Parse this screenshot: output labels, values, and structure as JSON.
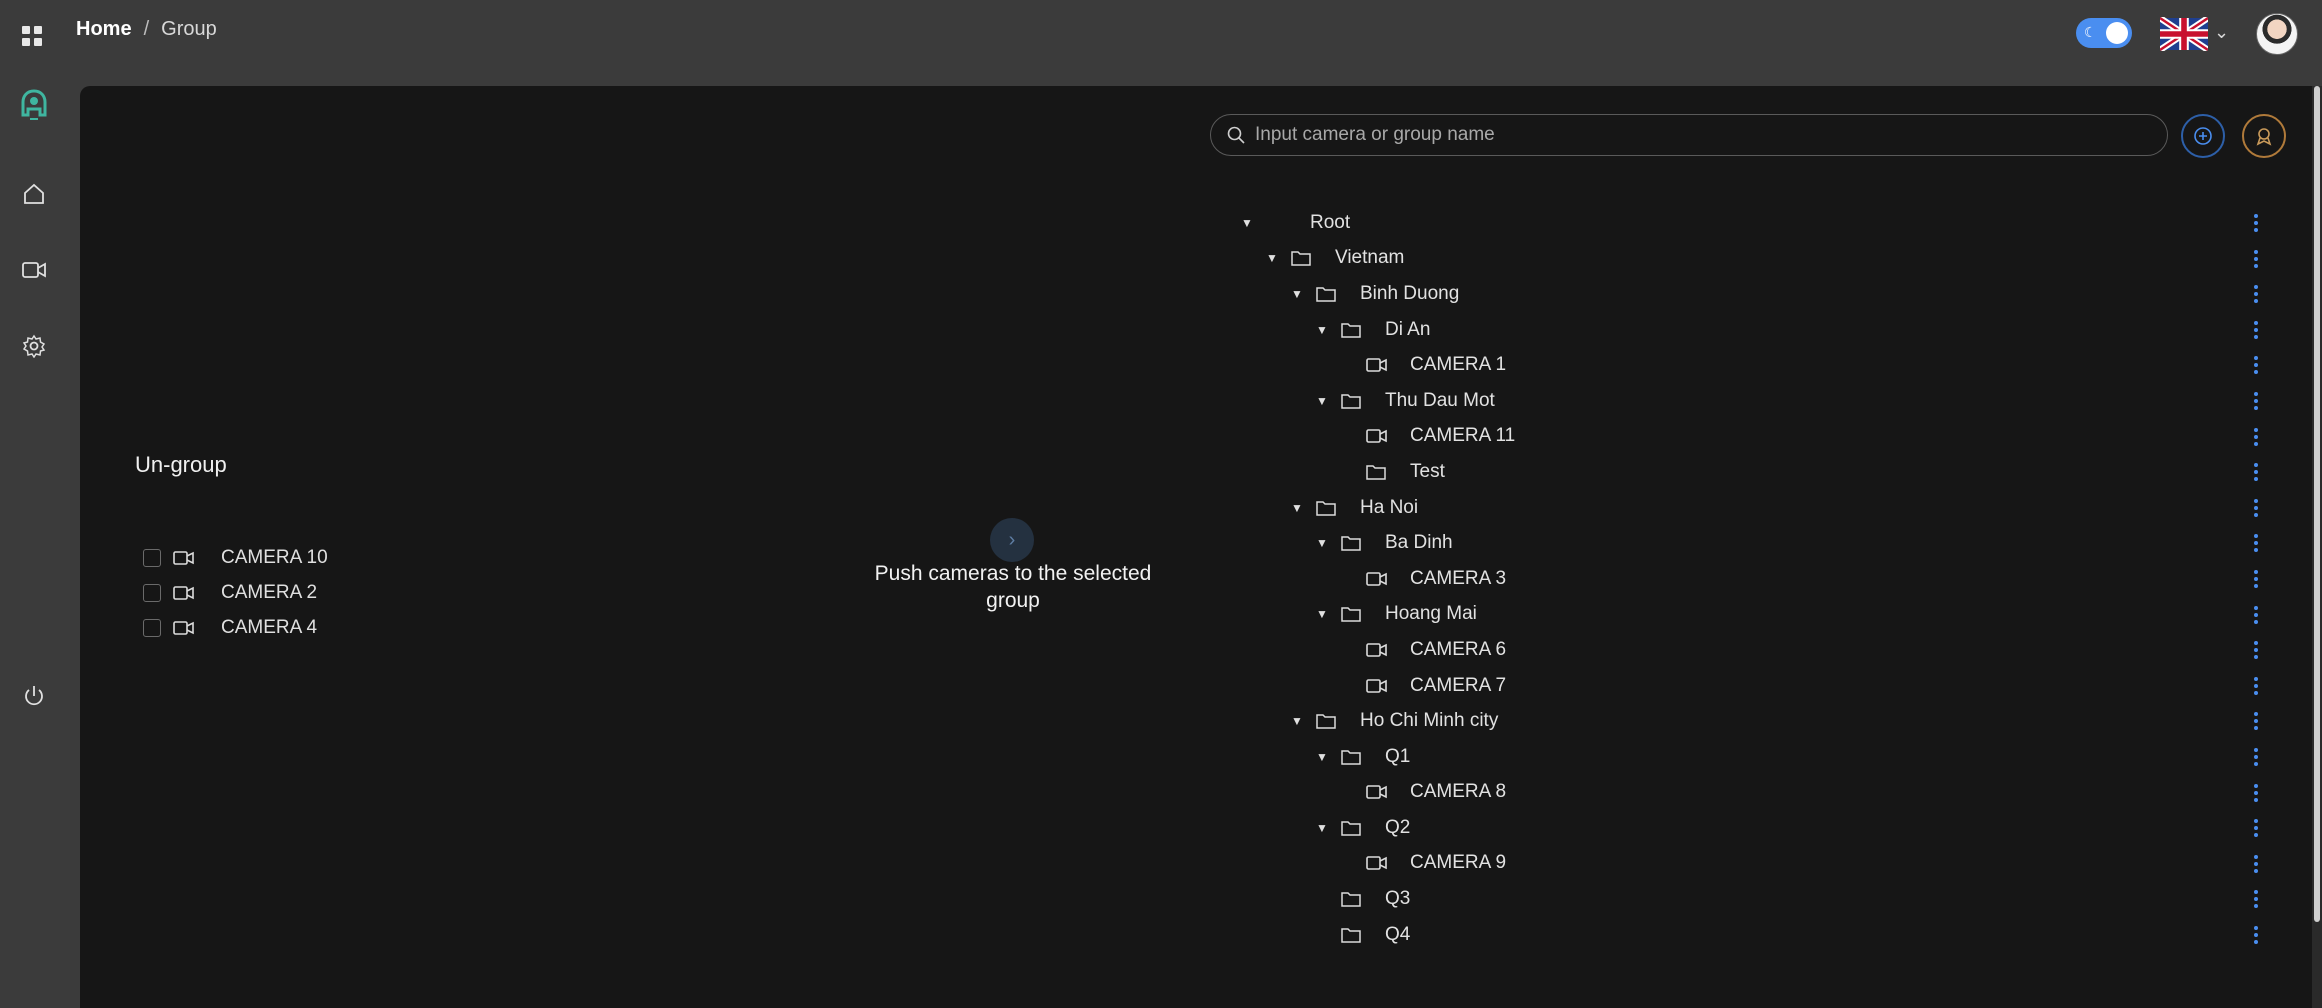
{
  "header": {
    "breadcrumb": {
      "home": "Home",
      "separator": "/",
      "current": "Group"
    },
    "theme_toggle_on": true,
    "language_icon": "uk-flag-icon"
  },
  "sidebar": {
    "items": [
      {
        "icon": "app-logo-icon"
      },
      {
        "icon": "home-icon"
      },
      {
        "icon": "camera-icon"
      },
      {
        "icon": "settings-icon"
      },
      {
        "icon": "power-icon"
      }
    ]
  },
  "ungroup": {
    "title": "Un-group",
    "items": [
      {
        "label": "CAMERA 10"
      },
      {
        "label": "CAMERA 2"
      },
      {
        "label": "CAMERA 4"
      }
    ]
  },
  "push": {
    "label": "Push cameras to the selected group"
  },
  "search": {
    "placeholder": "Input camera or group name"
  },
  "tree": {
    "nodes": [
      {
        "label": "Root",
        "level": 0,
        "type": "root",
        "expanded": true
      },
      {
        "label": "Vietnam",
        "level": 1,
        "type": "folder",
        "expanded": true
      },
      {
        "label": "Binh Duong",
        "level": 2,
        "type": "folder",
        "expanded": true
      },
      {
        "label": "Di An",
        "level": 3,
        "type": "folder",
        "expanded": true
      },
      {
        "label": "CAMERA 1",
        "level": 4,
        "type": "camera"
      },
      {
        "label": "Thu Dau Mot",
        "level": 3,
        "type": "folder",
        "expanded": true
      },
      {
        "label": "CAMERA 11",
        "level": 4,
        "type": "camera"
      },
      {
        "label": "Test",
        "level": 4,
        "type": "folder"
      },
      {
        "label": "Ha Noi",
        "level": 2,
        "type": "folder",
        "expanded": true
      },
      {
        "label": "Ba Dinh",
        "level": 3,
        "type": "folder",
        "expanded": true
      },
      {
        "label": "CAMERA 3",
        "level": 4,
        "type": "camera"
      },
      {
        "label": "Hoang Mai",
        "level": 3,
        "type": "folder",
        "expanded": true
      },
      {
        "label": "CAMERA 6",
        "level": 4,
        "type": "camera"
      },
      {
        "label": "CAMERA 7",
        "level": 4,
        "type": "camera"
      },
      {
        "label": "Ho Chi Minh city",
        "level": 2,
        "type": "folder",
        "expanded": true
      },
      {
        "label": "Q1",
        "level": 3,
        "type": "folder",
        "expanded": true
      },
      {
        "label": "CAMERA 8",
        "level": 4,
        "type": "camera"
      },
      {
        "label": "Q2",
        "level": 3,
        "type": "folder",
        "expanded": true
      },
      {
        "label": "CAMERA 9",
        "level": 4,
        "type": "camera"
      },
      {
        "label": "Q3",
        "level": 3,
        "type": "folder"
      },
      {
        "label": "Q4",
        "level": 3,
        "type": "folder"
      }
    ]
  }
}
